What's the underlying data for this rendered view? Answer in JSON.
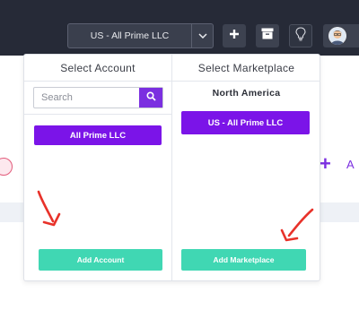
{
  "topbar": {
    "account_selector": "US - All Prime LLC",
    "icons": [
      "chevron-down-icon",
      "plus-icon",
      "archive-icon",
      "lightbulb-icon",
      "avatar"
    ]
  },
  "panel": {
    "account_column": {
      "heading": "Select Account",
      "search_placeholder": "Search",
      "accounts": [
        "All Prime LLC"
      ],
      "add_button": "Add Account"
    },
    "marketplace_column": {
      "heading": "Select Marketplace",
      "region": "North America",
      "marketplaces": [
        "US - All Prime LLC"
      ],
      "add_button": "Add Marketplace"
    }
  },
  "background": {
    "partial_text": "A"
  },
  "colors": {
    "topbar": "#262a37",
    "accent_purple": "#7b14e8",
    "add_button_teal": "#40d7b3",
    "annotation_arrow": "#e8322a"
  }
}
